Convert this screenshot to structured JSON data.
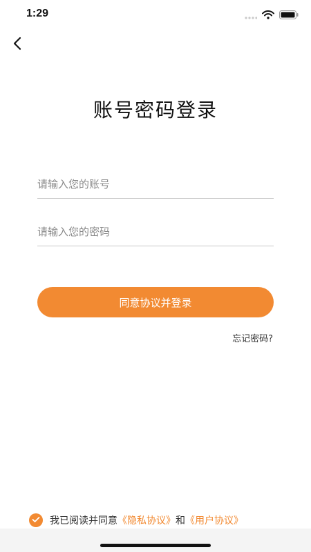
{
  "status_bar": {
    "time": "1:29"
  },
  "header": {
    "title": "账号密码登录"
  },
  "form": {
    "account_placeholder": "请输入您的账号",
    "account_value": "",
    "password_placeholder": "请输入您的密码",
    "password_value": "",
    "login_label": "同意协议并登录",
    "forgot_label": "忘记密码?"
  },
  "agreement": {
    "checked": true,
    "prefix": "我已阅读并同意",
    "privacy_link": "《隐私协议》",
    "and": "和",
    "user_link": "《用户协议》"
  },
  "colors": {
    "accent": "#f28a32"
  }
}
